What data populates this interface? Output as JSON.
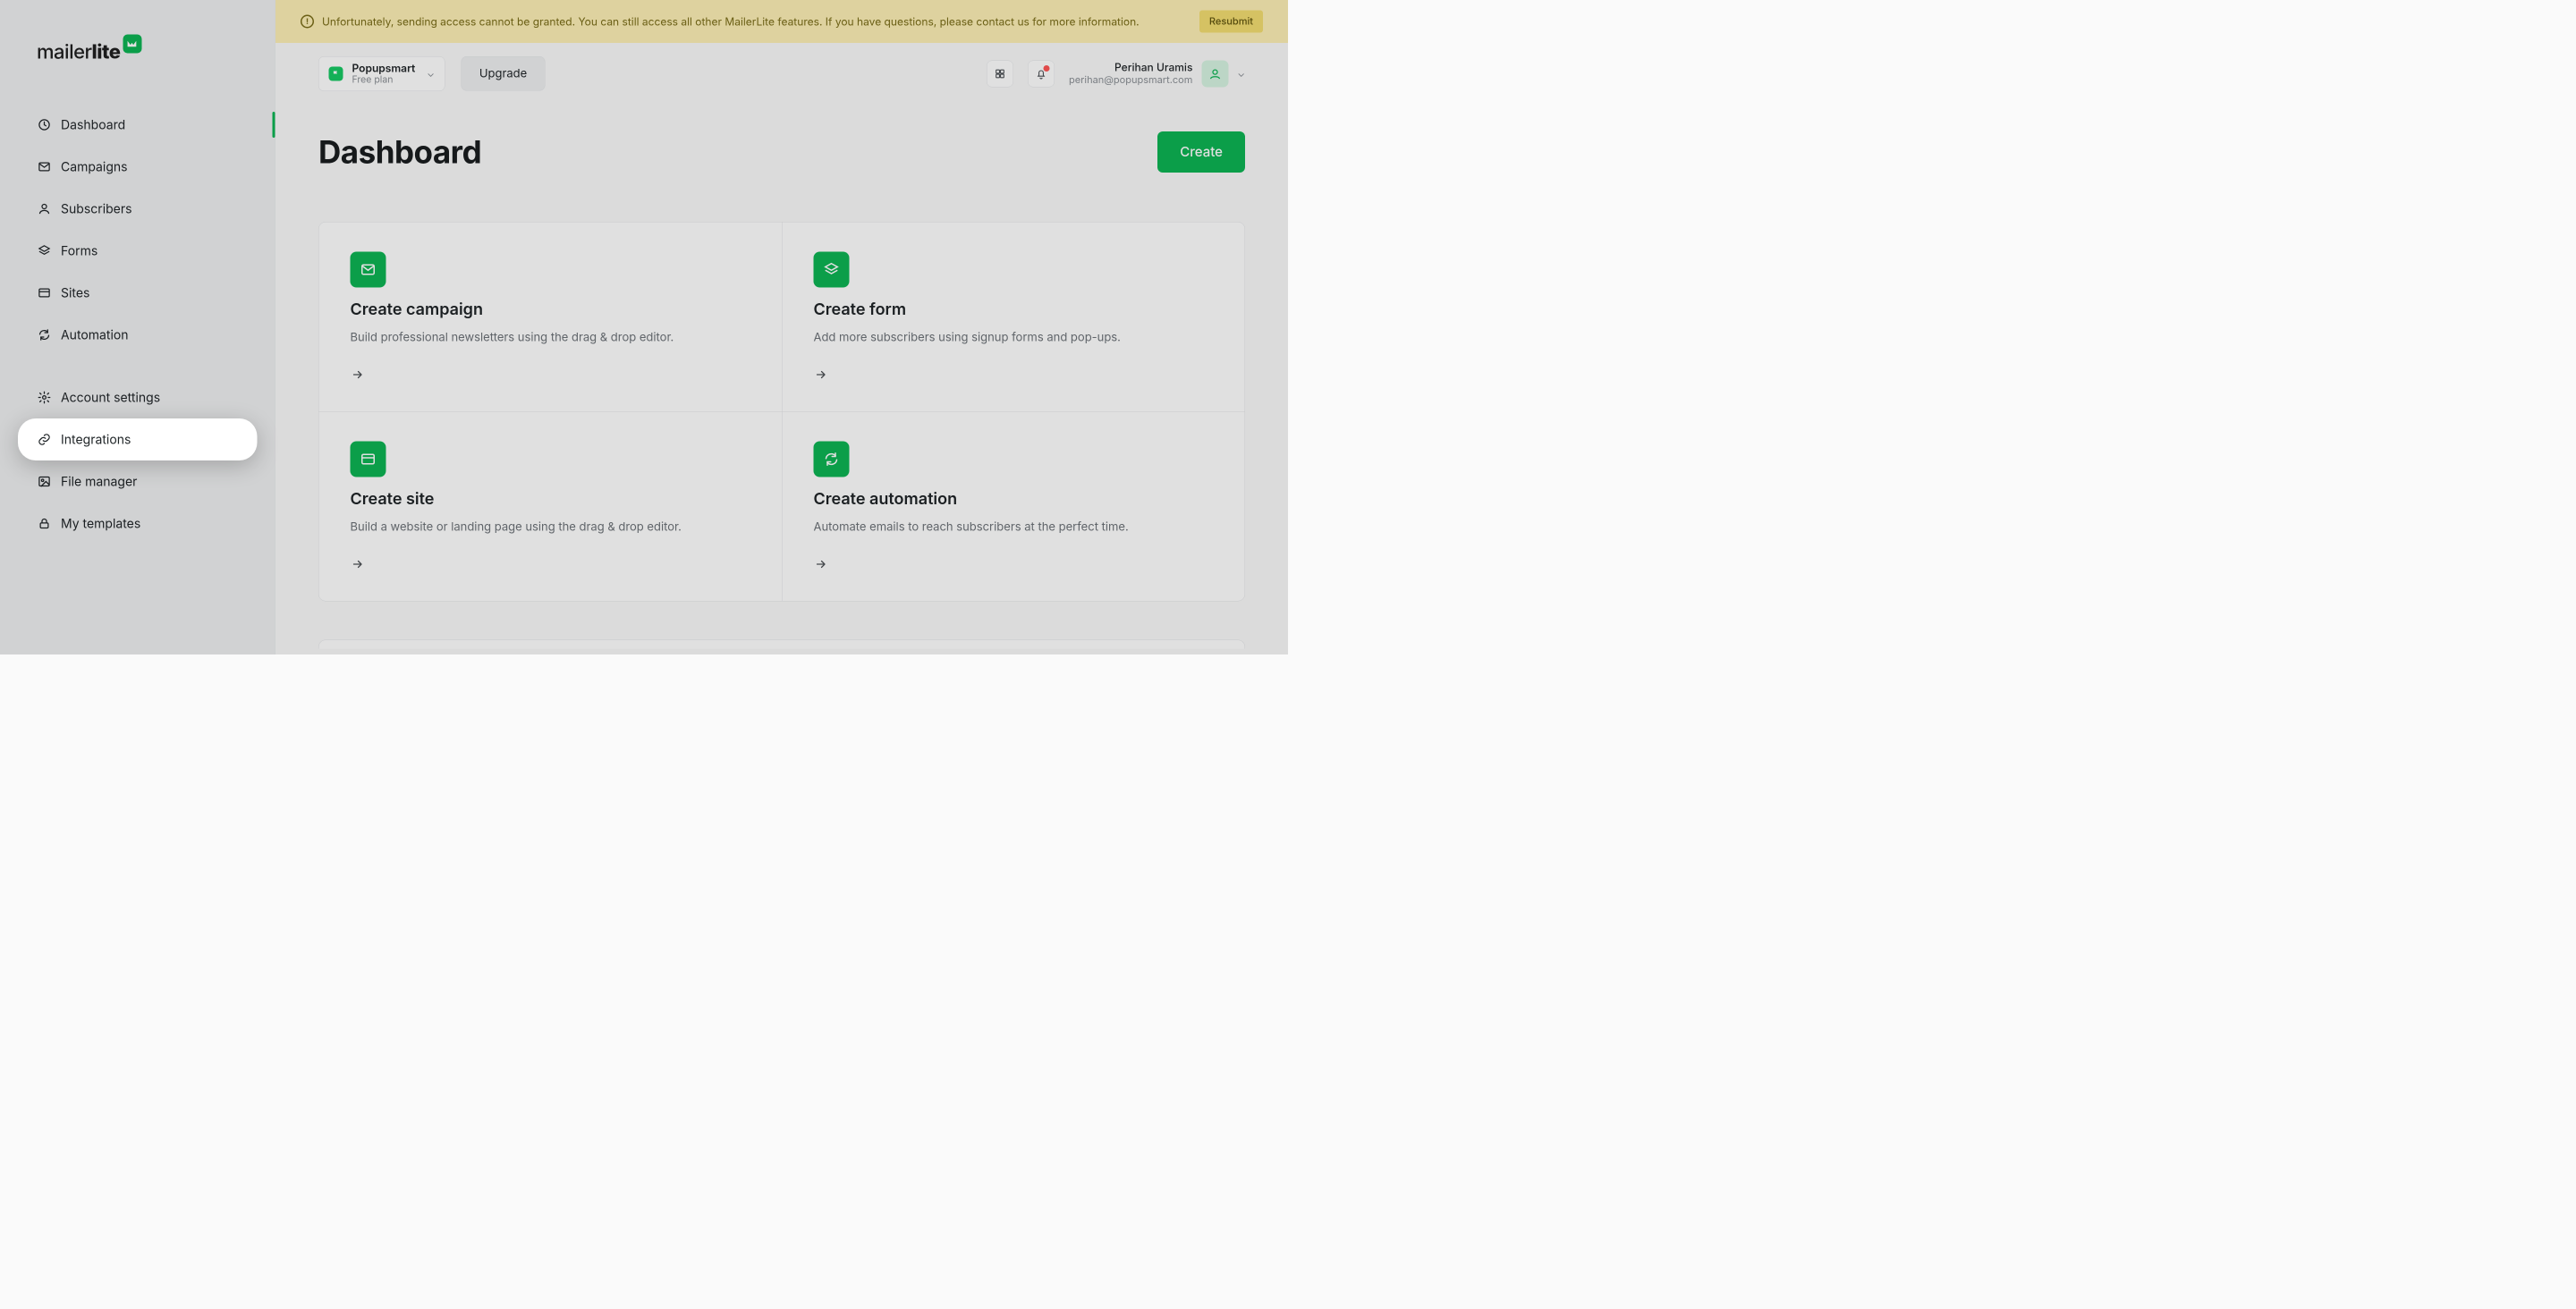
{
  "brand": {
    "name_regular": "mailer",
    "name_bold": "lite"
  },
  "sidebar": {
    "groupA": [
      {
        "id": "dashboard",
        "label": "Dashboard",
        "icon": "clock",
        "active": true
      },
      {
        "id": "campaigns",
        "label": "Campaigns",
        "icon": "mail"
      },
      {
        "id": "subscribers",
        "label": "Subscribers",
        "icon": "user"
      },
      {
        "id": "forms",
        "label": "Forms",
        "icon": "layers"
      },
      {
        "id": "sites",
        "label": "Sites",
        "icon": "sites"
      },
      {
        "id": "automation",
        "label": "Automation",
        "icon": "refresh"
      }
    ],
    "groupB": [
      {
        "id": "account-settings",
        "label": "Account settings",
        "icon": "gear"
      },
      {
        "id": "integrations",
        "label": "Integrations",
        "icon": "link",
        "highlight": true
      },
      {
        "id": "file-manager",
        "label": "File manager",
        "icon": "image"
      },
      {
        "id": "my-templates",
        "label": "My templates",
        "icon": "lock"
      }
    ]
  },
  "banner": {
    "text": "Unfortunately, sending access cannot be granted. You can still access all other MailerLite features. If you have questions, please contact us for more information.",
    "button": "Resubmit"
  },
  "topbar": {
    "workspace": {
      "name": "Popupsmart",
      "plan": "Free plan"
    },
    "upgrade_label": "Upgrade",
    "user": {
      "name": "Perihan Uramis",
      "email": "perihan@popupsmart.com"
    }
  },
  "page": {
    "title": "Dashboard",
    "create_label": "Create"
  },
  "cards": [
    {
      "id": "create-campaign",
      "icon": "mail",
      "title": "Create campaign",
      "desc": "Build professional newsletters using the drag & drop editor."
    },
    {
      "id": "create-form",
      "icon": "layers",
      "title": "Create form",
      "desc": "Add more subscribers using signup forms and pop-ups."
    },
    {
      "id": "create-site",
      "icon": "sites",
      "title": "Create site",
      "desc": "Build a website or landing page using the drag & drop editor."
    },
    {
      "id": "create-automation",
      "icon": "refresh",
      "title": "Create automation",
      "desc": "Automate emails to reach subscribers at the perfect time."
    }
  ]
}
